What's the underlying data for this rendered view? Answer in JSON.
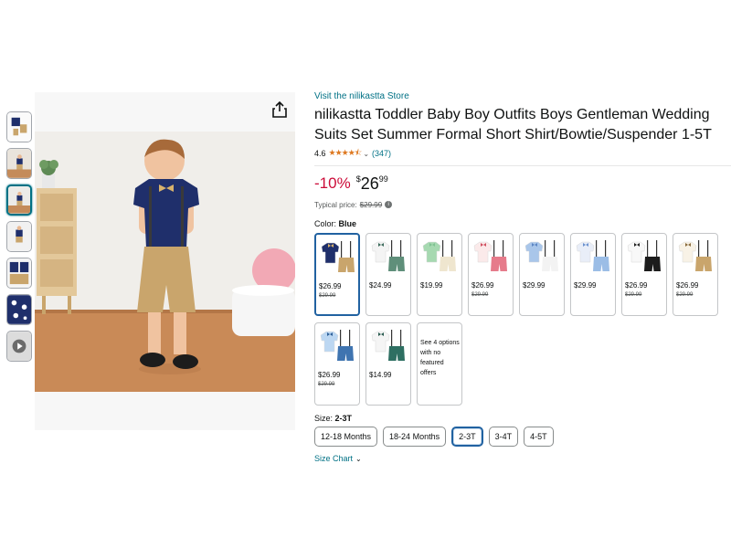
{
  "store_link": "Visit the nilikastta Store",
  "title": "nilikastta Toddler Baby Boy Outfits Boys Gentleman Wedding Suits Set Summer Formal Short Shirt/Bowtie/Suspender 1-5T",
  "rating": {
    "value": "4.6",
    "stars": "★★★★⯪",
    "count": "(347)"
  },
  "price": {
    "discount": "-10%",
    "currency": "$",
    "whole": "26",
    "fraction": "99"
  },
  "typical_price": {
    "label": "Typical price:",
    "value": "$29.99"
  },
  "color": {
    "label": "Color:",
    "selected": "Blue"
  },
  "swatches": [
    {
      "price": "$26.99",
      "old": "$29.99",
      "shirt": "#1f2f6b",
      "shorts": "#c9a56c",
      "bow": "#d9b36c"
    },
    {
      "price": "$24.99",
      "old": "",
      "shirt": "#f4f4f4",
      "shorts": "#5f8f7a",
      "bow": "#3c6b5c"
    },
    {
      "price": "$19.99",
      "old": "",
      "shirt": "#a6d9b1",
      "shorts": "#efe6cf",
      "bow": "#7fc293"
    },
    {
      "price": "$26.99",
      "old": "$29.99",
      "shirt": "#fbeaea",
      "shorts": "#e67b8b",
      "bow": "#d05060"
    },
    {
      "price": "$29.99",
      "old": "",
      "shirt": "#a9c6ea",
      "shorts": "#f3f3f3",
      "bow": "#5d86c4"
    },
    {
      "price": "$29.99",
      "old": "",
      "shirt": "#e9eef8",
      "shorts": "#9bbde6",
      "bow": "#6c93cf"
    },
    {
      "price": "$26.99",
      "old": "$29.99",
      "shirt": "#f8f8f8",
      "shorts": "#1c1c1c",
      "bow": "#222222"
    },
    {
      "price": "$26.99",
      "old": "$29.99",
      "shirt": "#f8f2e6",
      "shorts": "#c9a56c",
      "bow": "#8a6b3c"
    },
    {
      "price": "$26.99",
      "old": "$29.99",
      "shirt": "#bcd7f2",
      "shorts": "#3f74b0",
      "bow": "#2d5f99"
    },
    {
      "price": "$14.99",
      "old": "",
      "shirt": "#f5f5f5",
      "shorts": "#2e6f62",
      "bow": "#2a5c50"
    }
  ],
  "no_offer_text": "See 4 options with no featured offers",
  "size": {
    "label": "Size:",
    "selected": "2-3T",
    "options": [
      "12-18 Months",
      "18-24 Months",
      "2-3T",
      "3-4T",
      "4-5T"
    ]
  },
  "size_chart": "Size Chart",
  "colors": {
    "link": "#007185",
    "deal": "#cc0c39",
    "star": "#de7921",
    "selected_border": "#2162a1"
  }
}
